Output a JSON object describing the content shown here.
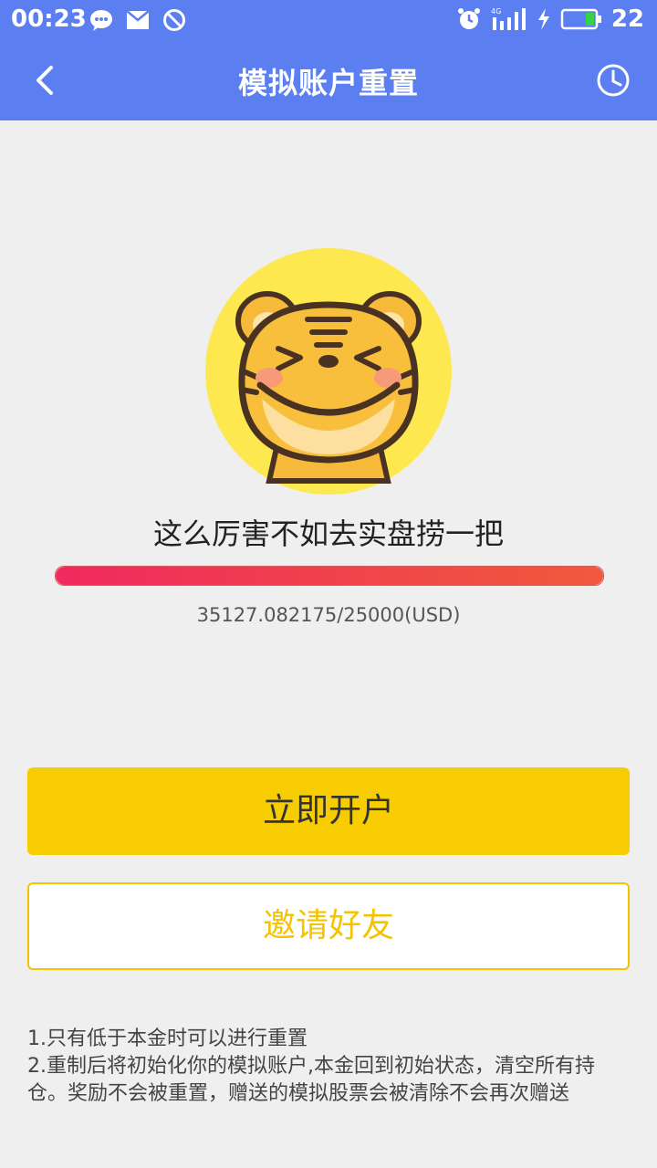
{
  "status_bar": {
    "time": "00:23",
    "battery_level": "22",
    "network": "4G"
  },
  "header": {
    "title": "模拟账户重置"
  },
  "hero": {
    "slogan": "这么厉害不如去实盘捞一把",
    "balance_text": "35127.082175/25000(USD)",
    "progress_fraction": 1.0
  },
  "actions": {
    "open_account_label": "立即开户",
    "invite_friends_label": "邀请好友"
  },
  "notes": [
    "1.只有低于本金时可以进行重置",
    "2.重制后将初始化你的模拟账户,本金回到初始状态，清空所有持仓。奖励不会被重置，赠送的模拟股票会被清除不会再次赠送"
  ],
  "colors": {
    "header_bg": "#5b7ff0",
    "primary_button": "#f7cc00",
    "progress_start": "#f0295e",
    "progress_end": "#f05a3c"
  }
}
